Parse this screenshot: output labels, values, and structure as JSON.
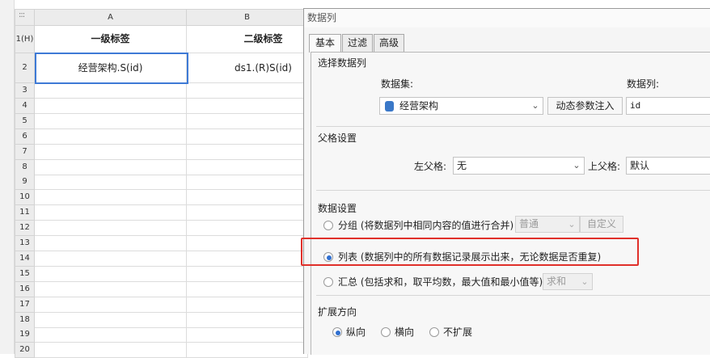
{
  "spreadsheet": {
    "corner_label": ":::",
    "columns": [
      "A",
      "B"
    ],
    "row_labels": [
      "1(H)",
      "2",
      "3",
      "4",
      "5",
      "6",
      "7",
      "8",
      "9",
      "10",
      "11",
      "12",
      "13",
      "14",
      "15",
      "16",
      "17",
      "18",
      "19",
      "20"
    ],
    "header_cells": [
      "一级标签",
      "二级标签"
    ],
    "row2_cells": [
      "经营架构.S(id)",
      "ds1.(R)S(id)"
    ]
  },
  "dialog": {
    "title": "数据列",
    "tabs": [
      "基本",
      "过滤",
      "高级"
    ],
    "select_section": {
      "title": "选择数据列",
      "dataset_label": "数据集:",
      "column_label": "数据列:",
      "dataset_value": "经营架构",
      "inject_button": "动态参数注入",
      "column_value": "id"
    },
    "parent_section": {
      "title": "父格设置",
      "left_parent_label": "左父格:",
      "left_parent_value": "无",
      "top_parent_label": "上父格:",
      "top_parent_value": "默认"
    },
    "data_section": {
      "title": "数据设置",
      "group_label": "分组 (将数据列中相同内容的值进行合并)",
      "group_select": "普通",
      "custom_button": "自定义",
      "list_label": "列表 (数据列中的所有数据记录展示出来，无论数据是否重复)",
      "summary_label": "汇总 (包括求和，取平均数，最大值和最小值等)",
      "summary_select": "求和",
      "selected": "列表"
    },
    "expand_section": {
      "title": "扩展方向",
      "options": [
        "纵向",
        "横向",
        "不扩展"
      ],
      "selected": "纵向"
    }
  },
  "colors": {
    "selection": "#3e7ad6",
    "highlight": "#e0302a",
    "radio_on": "#2f6fd0"
  }
}
